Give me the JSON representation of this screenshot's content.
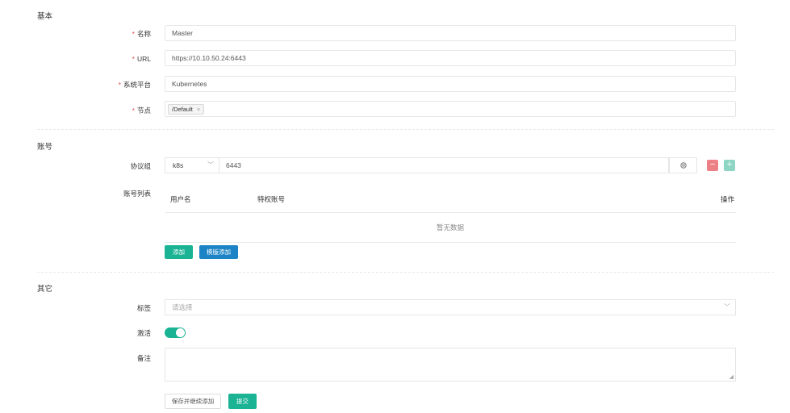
{
  "sections": {
    "basic": "基本",
    "account": "账号",
    "other": "其它"
  },
  "required_mark": "*",
  "fields": {
    "name": {
      "label": "名称",
      "value": "Master"
    },
    "url": {
      "label": "URL",
      "value": "https://10.10.50.24:6443"
    },
    "platform": {
      "label": "系统平台",
      "value": "Kubernetes"
    },
    "nodes": {
      "label": "节点",
      "tag": "/Default",
      "tag_remove": "×"
    }
  },
  "account": {
    "protocol_label": "协议组",
    "protocol": "k8s",
    "port": "6443",
    "account_list_label": "账号列表",
    "columns": [
      "用户名",
      "特权账号",
      "操作"
    ],
    "empty_text": "暂无数据",
    "add_button": "添加",
    "template_add_button": "模版添加",
    "minus": "−",
    "plus": "+"
  },
  "other": {
    "tags_label": "标签",
    "tags_placeholder": "请选择",
    "active_label": "激活",
    "active": true,
    "comment_label": "备注"
  },
  "actions": {
    "save_continue": "保存并继续添加",
    "submit": "提交"
  },
  "colors": {
    "primary": "#1ab394",
    "info": "#1c84c6",
    "danger_light": "#ed7f86",
    "success_light": "#8fd5c3",
    "required": "#e0504f"
  }
}
